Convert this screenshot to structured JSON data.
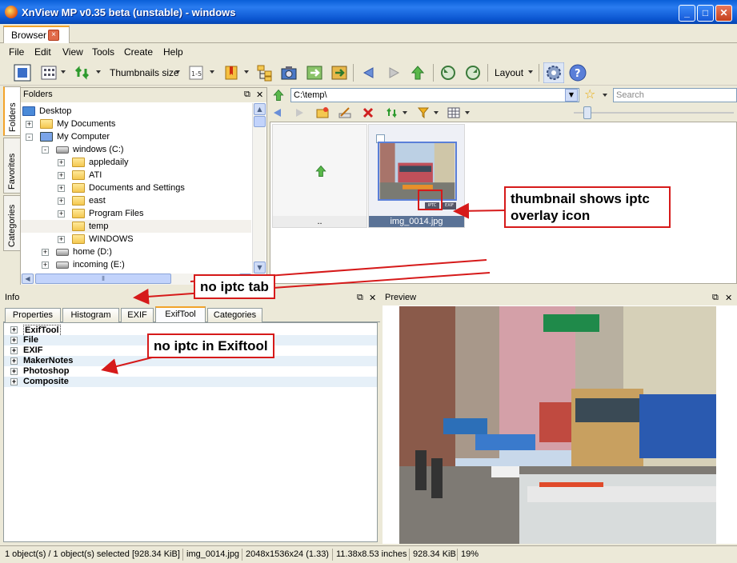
{
  "window": {
    "title": "XnView MP v0.35 beta (unstable) - windows"
  },
  "tabs": [
    {
      "label": "Browser"
    }
  ],
  "menu": [
    "File",
    "Edit",
    "View",
    "Tools",
    "Create",
    "Help"
  ],
  "toolbar": {
    "thumbnails_label": "Thumbnails size",
    "layout_label": "Layout"
  },
  "side_tabs": [
    "Folders",
    "Favorites",
    "Categories"
  ],
  "folders": {
    "title": "Folders",
    "tree": [
      {
        "label": "Desktop",
        "level": 0,
        "icon": "desktop-icon"
      },
      {
        "label": "My Documents",
        "level": 1,
        "icon": "folder-icon"
      },
      {
        "label": "My Computer",
        "level": 1,
        "icon": "computer-icon"
      },
      {
        "label": "windows (C:)",
        "level": 2,
        "icon": "drive-icon"
      },
      {
        "label": "appledaily",
        "level": 3,
        "icon": "folder-icon"
      },
      {
        "label": "ATI",
        "level": 3,
        "icon": "folder-icon"
      },
      {
        "label": "Documents and Settings",
        "level": 3,
        "icon": "folder-icon"
      },
      {
        "label": "east",
        "level": 3,
        "icon": "folder-icon"
      },
      {
        "label": "Program Files",
        "level": 3,
        "icon": "folder-icon"
      },
      {
        "label": "temp",
        "level": 3,
        "icon": "folder-icon",
        "selected": true
      },
      {
        "label": "WINDOWS",
        "level": 3,
        "icon": "folder-icon"
      },
      {
        "label": "home (D:)",
        "level": 2,
        "icon": "drive-icon"
      },
      {
        "label": "incoming (E:)",
        "level": 2,
        "icon": "drive-icon"
      }
    ]
  },
  "address": {
    "path": "C:\\temp\\",
    "search_placeholder": "Search"
  },
  "thumbnails": [
    {
      "label": "..",
      "kind": "parent-folder"
    },
    {
      "label": "img_0014.jpg",
      "kind": "image",
      "badges": [
        "IPTC",
        "EXIF"
      ]
    }
  ],
  "info": {
    "title": "Info",
    "tabs": [
      "Properties",
      "Histogram",
      "EXIF",
      "ExifTool",
      "Categories"
    ],
    "active_tab": "ExifTool",
    "groups": [
      "ExifTool",
      "File",
      "EXIF",
      "MakerNotes",
      "Photoshop",
      "Composite"
    ]
  },
  "preview": {
    "title": "Preview"
  },
  "status": {
    "selection": "1 object(s) / 1 object(s) selected [928.34 KiB]",
    "filename": "img_0014.jpg",
    "dimensions": "2048x1536x24 (1.33)",
    "print_size": "11.38x8.53 inches",
    "filesize": "928.34 KiB",
    "zoom": "19%"
  },
  "annotations": {
    "thumb": "thumbnail shows iptc overlay icon",
    "no_tab": "no iptc tab",
    "no_exiftool": "no iptc in Exiftool"
  },
  "colors": {
    "annotation": "#d61a1a",
    "accent": "#f2a32a",
    "titlebar": "#0a5fd8"
  }
}
